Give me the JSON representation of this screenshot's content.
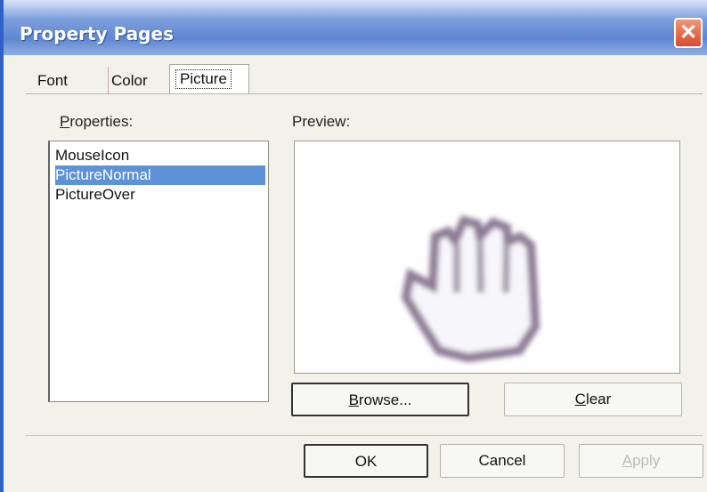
{
  "window": {
    "title": "Property Pages",
    "close_label": "✕"
  },
  "tabs": [
    {
      "label": "Font",
      "selected": false
    },
    {
      "label": "Color",
      "selected": false
    },
    {
      "label": "Picture",
      "selected": true
    }
  ],
  "properties": {
    "label_access": "P",
    "label_rest": "roperties:",
    "items": [
      {
        "label": "MouseIcon",
        "selected": false
      },
      {
        "label": "PictureNormal",
        "selected": true
      },
      {
        "label": "PictureOver",
        "selected": false
      }
    ]
  },
  "preview": {
    "label": "Preview:",
    "image_icon": "hand-cursor-icon"
  },
  "buttons": {
    "browse_access": "B",
    "browse_rest": "rowse...",
    "clear_access": "C",
    "clear_rest": "lear",
    "ok": "OK",
    "cancel": "Cancel",
    "apply_access": "A",
    "apply_rest": "pply"
  },
  "colors": {
    "selection": "#5d91d8",
    "title_bar": "#6f96d8",
    "close_button": "#e05a36"
  }
}
